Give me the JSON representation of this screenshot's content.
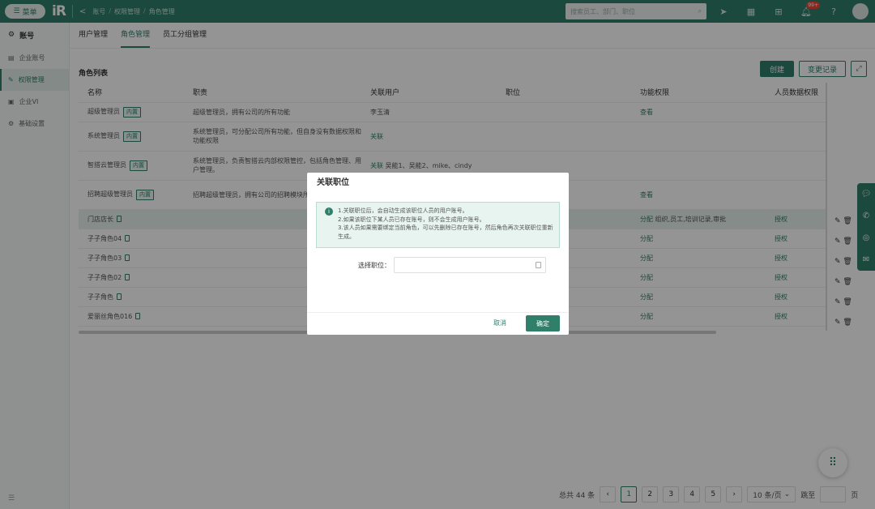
{
  "topbar": {
    "menu_label": "菜单",
    "logo": "iR",
    "breadcrumb": [
      "账号",
      "权限管理",
      "角色管理"
    ],
    "search_placeholder": "搜索员工、部门、职位",
    "notification_badge": "99+"
  },
  "sidebar": {
    "title": "账号",
    "items": [
      {
        "label": "企业账号"
      },
      {
        "label": "权限管理"
      },
      {
        "label": "企业VI"
      },
      {
        "label": "基础设置"
      }
    ]
  },
  "tabs": [
    {
      "label": "用户管理"
    },
    {
      "label": "角色管理"
    },
    {
      "label": "员工分组管理"
    }
  ],
  "list_title": "角色列表",
  "buttons": {
    "create": "创建",
    "change_log": "变更记录"
  },
  "table": {
    "headers": [
      "名称",
      "职责",
      "关联用户",
      "职位",
      "功能权限",
      "人员数据权限"
    ],
    "builtin_tag": "内置",
    "rows": [
      {
        "name": "超级管理员",
        "duty": "超级管理员，拥有公司的所有功能",
        "users": "李玉清",
        "users_link": "",
        "func": "查看",
        "func_extra": "",
        "data": ""
      },
      {
        "name": "系统管理员",
        "duty": "系统管理员，可分配公司所有功能，但自身没有数据权限和功能权限",
        "users": "",
        "users_link": "关联",
        "func": "",
        "func_extra": "",
        "data": ""
      },
      {
        "name": "智搭云管理员",
        "duty": "系统管理员，负责智搭云内部权限管控，包括角色管理、用户管理。",
        "users": "吴能1、吴能2、mike、cindy",
        "users_link": "关联",
        "func": "",
        "func_extra": "",
        "data": ""
      },
      {
        "name": "招聘超级管理员",
        "duty": "招聘超级管理员，拥有公司的招聘模块所有权限和功能权限",
        "users": "",
        "users_link": "",
        "func": "查看",
        "func_extra": "",
        "data": ""
      },
      {
        "name": "门店店长",
        "duty": "",
        "users": "",
        "users_link": "",
        "func": "分配",
        "func_extra": "组织,员工,培训记录,审批",
        "data": "授权"
      },
      {
        "name": "子子角色04",
        "duty": "",
        "users": "",
        "users_link": "",
        "func": "分配",
        "func_extra": "",
        "data": "授权"
      },
      {
        "name": "子子角色03",
        "duty": "",
        "users": "",
        "users_link": "",
        "func": "分配",
        "func_extra": "",
        "data": "授权"
      },
      {
        "name": "子子角色02",
        "duty": "",
        "users": "",
        "users_link": "",
        "func": "分配",
        "func_extra": "",
        "data": "授权"
      },
      {
        "name": "子子角色",
        "duty": "",
        "users": "",
        "users_link": "",
        "func": "分配",
        "func_extra": "",
        "data": "授权"
      },
      {
        "name": "爱丽丝角色016",
        "duty": "",
        "users": "",
        "users_link": "",
        "func": "分配",
        "func_extra": "",
        "data": "授权"
      }
    ]
  },
  "pagination": {
    "total": "总共 44 条",
    "pages": [
      "1",
      "2",
      "3",
      "4",
      "5"
    ],
    "current": "1",
    "page_size": "10 条/页",
    "jump_label": "跳至",
    "page_suffix": "页"
  },
  "modal": {
    "title": "关联职位",
    "notice": [
      "1.关联职位后，会自动生成该职位人员的用户账号。",
      "2.如果该职位下某人员已存在账号，则不会生成用户账号。",
      "3.该人员如果需要绑定当前角色，可以先删除已存在账号，然后角色再次关联职位重新生成。"
    ],
    "field_label": "选择职位：",
    "cancel": "取消",
    "confirm": "确定"
  }
}
